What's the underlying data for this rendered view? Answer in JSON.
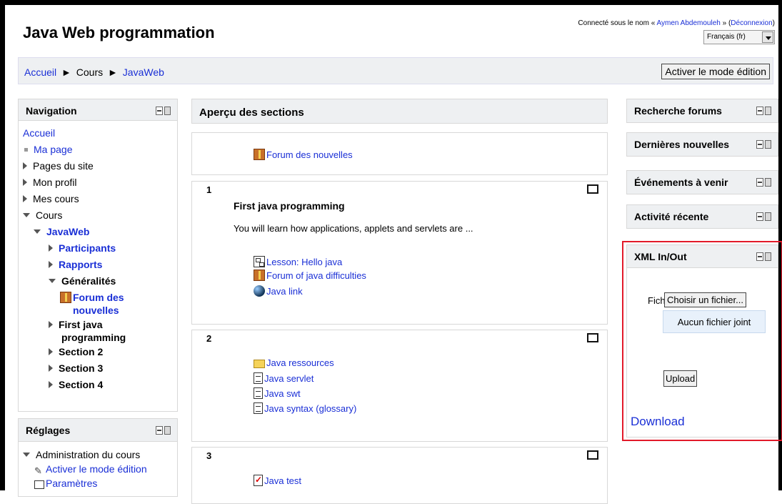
{
  "header": {
    "site_title": "Java Web programmation",
    "login_prefix": "Connecté sous le nom « ",
    "user_name": "Aymen Abdemouleh",
    "login_mid": " » (",
    "logout_label": "Déconnexion",
    "login_suffix": ")",
    "language": "Français (fr)"
  },
  "navbar": {
    "crumbs": [
      "Accueil",
      "Cours",
      "JavaWeb"
    ],
    "separator": "►",
    "edit_button": "Activer le mode édition"
  },
  "navigation_block": {
    "title": "Navigation",
    "items": [
      "Accueil",
      "Ma page",
      "Pages du site",
      "Mon profil",
      "Mes cours",
      "Cours",
      "JavaWeb",
      "Participants",
      "Rapports",
      "Généralités",
      "Forum des",
      "nouvelles",
      "First java",
      "programming",
      "Section 2",
      "Section 3",
      "Section 4"
    ]
  },
  "settings_block": {
    "title": "Réglages",
    "items": [
      "Administration du cours",
      "Activer le mode édition",
      "Paramètres"
    ]
  },
  "main": {
    "heading": "Aperçu des sections",
    "section0": {
      "items": [
        "Forum des nouvelles"
      ]
    },
    "section1": {
      "number": "1",
      "title": "First java programming",
      "summary": "You will learn how applications, applets and servlets are ...",
      "items": [
        "Lesson: Hello java",
        "Forum of java difficulties",
        "Java link"
      ]
    },
    "section2": {
      "number": "2",
      "items": [
        "Java ressources",
        "Java servlet",
        "Java swt",
        "Java syntax (glossary)"
      ]
    },
    "section3": {
      "number": "3",
      "items": [
        "Java test"
      ]
    }
  },
  "right_blocks": {
    "search_forums": "Recherche forums",
    "latest_news": "Dernières nouvelles",
    "upcoming_events": "Événements à venir",
    "recent_activity": "Activité récente",
    "xml": {
      "title": "XML In/Out",
      "file_label": "Fich",
      "choose_button": "Choisir un fichier...",
      "no_file": "Aucun fichier joint",
      "upload_button": "Upload",
      "download_link": "Download"
    }
  },
  "colors": {
    "link": "#1a2fd6",
    "highlight_border": "#e21a2a",
    "header_bg": "#eef0f2"
  }
}
